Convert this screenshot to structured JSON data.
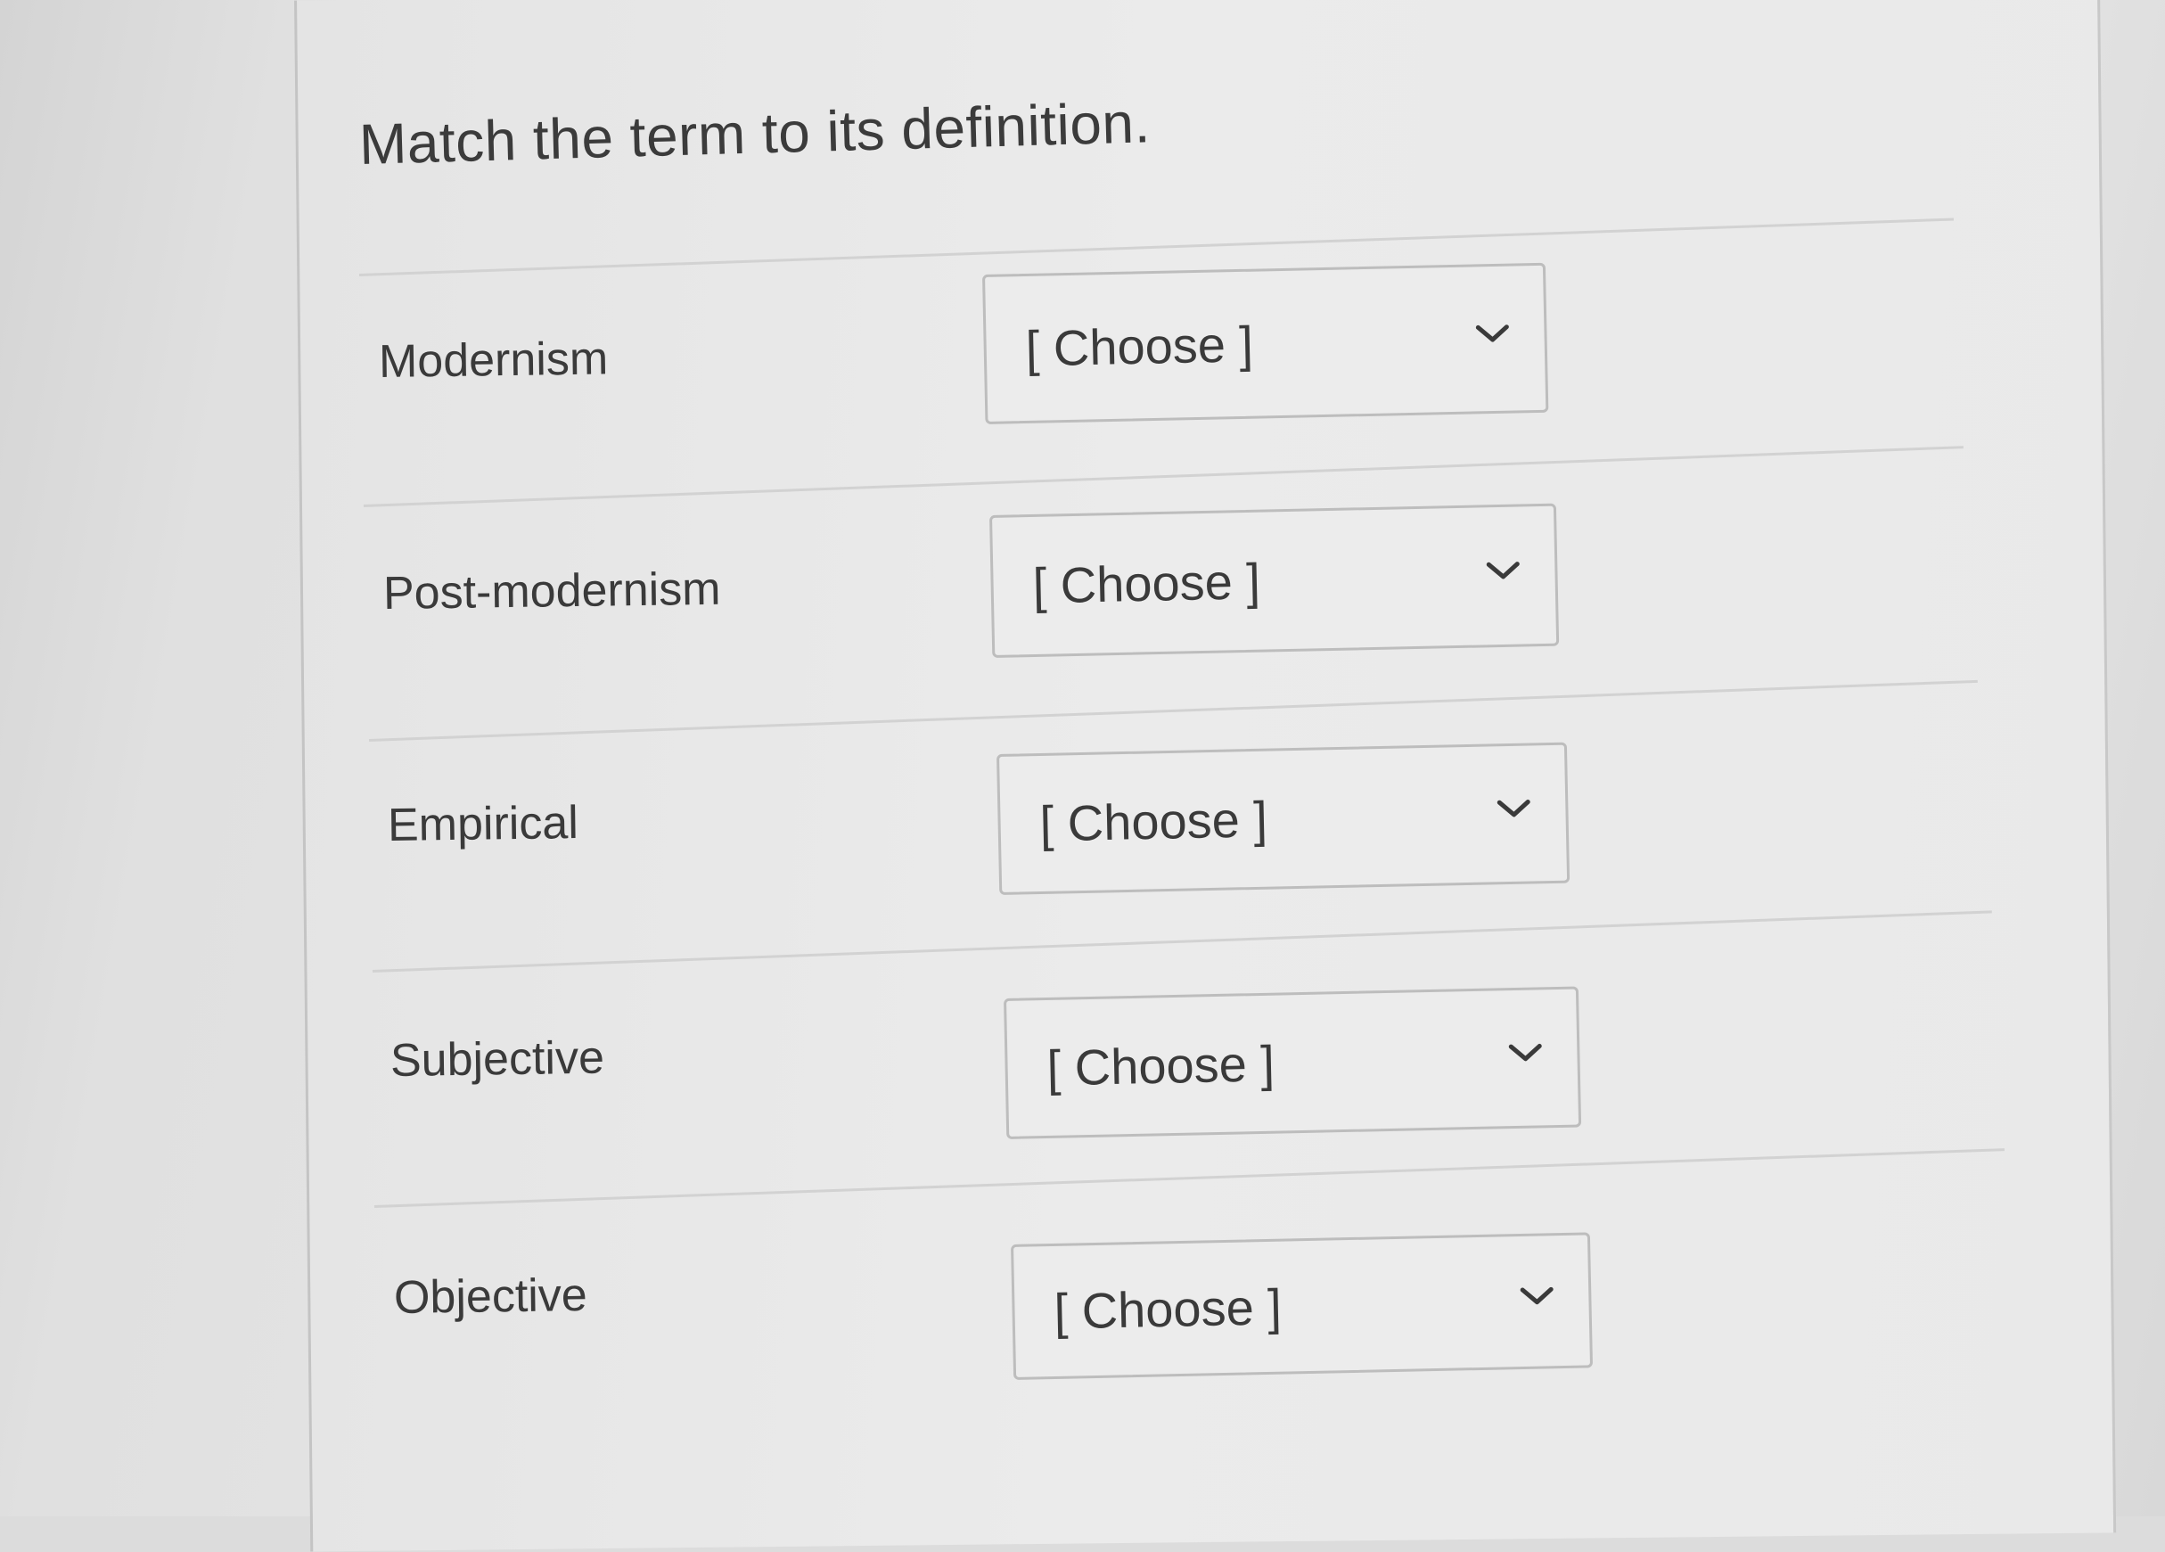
{
  "question": {
    "prompt": "Match the term to its definition."
  },
  "rows": [
    {
      "term": "Modernism",
      "selected": "[ Choose ]",
      "chevron_icon": "chevron-down-icon"
    },
    {
      "term": "Post-modernism",
      "selected": "[ Choose ]",
      "chevron_icon": "chevron-down-icon"
    },
    {
      "term": "Empirical",
      "selected": "[ Choose ]",
      "chevron_icon": "chevron-down-icon"
    },
    {
      "term": "Subjective",
      "selected": "[ Choose ]",
      "chevron_icon": "chevron-down-icon"
    },
    {
      "term": "Objective",
      "selected": "[ Choose ]",
      "chevron_icon": "chevron-down-icon"
    }
  ],
  "colors": {
    "text": "#3a3a3a",
    "border": "#bdbdbd",
    "background": "#e8e8e8"
  }
}
